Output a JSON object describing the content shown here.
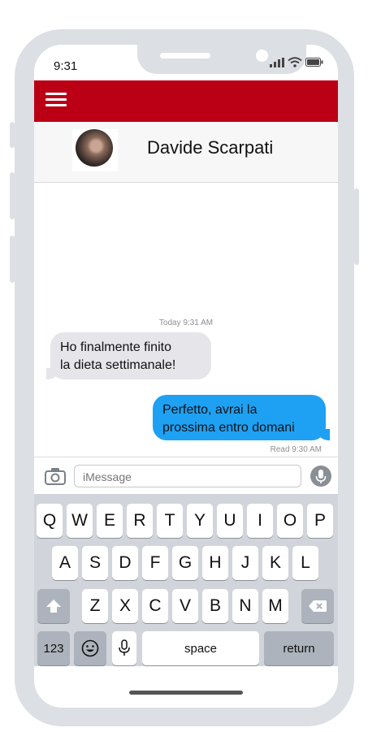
{
  "status_bar": {
    "time": "9:31"
  },
  "contact": {
    "name": "Davide Scarpati"
  },
  "thread": {
    "timestamp_today": "Today 9:31 AM",
    "incoming": {
      "text": "Ho finalmente finito\nla dieta settimanale!"
    },
    "outgoing": {
      "text": "Perfetto, avrai la\nprossima entro domani"
    },
    "read_receipt": "Read 9:30 AM"
  },
  "composer": {
    "placeholder": "iMessage",
    "value": ""
  },
  "keyboard": {
    "row1": [
      "Q",
      "W",
      "E",
      "R",
      "T",
      "Y",
      "U",
      "I",
      "O",
      "P"
    ],
    "row2": [
      "A",
      "S",
      "D",
      "F",
      "G",
      "H",
      "J",
      "K",
      "L"
    ],
    "row3": [
      "Z",
      "X",
      "C",
      "V",
      "B",
      "N",
      "M"
    ],
    "numbers_label": "123",
    "space_label": "space",
    "return_label": "return"
  },
  "colors": {
    "app_bar": "#bb0016",
    "outgoing_bubble": "#1ea1f3",
    "incoming_bubble": "#e5e5ea"
  }
}
